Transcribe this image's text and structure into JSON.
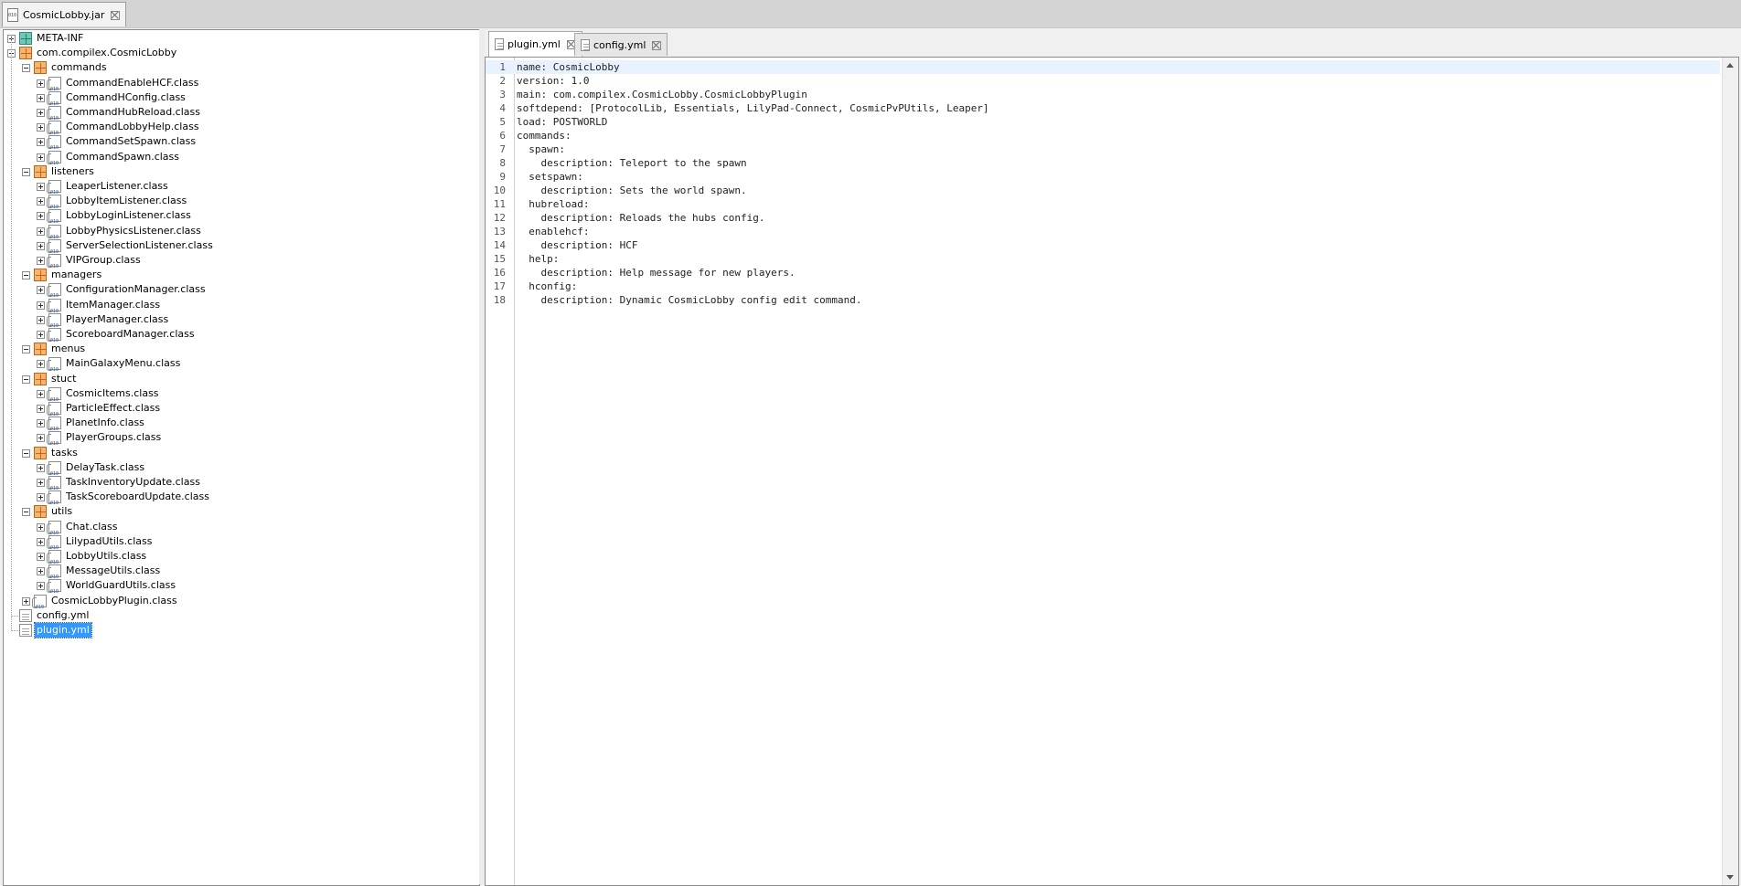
{
  "window": {
    "file_tab_label": "CosmicLobby.jar"
  },
  "tree": {
    "items": [
      {
        "label": "META-INF",
        "type": "meta",
        "depth": 0,
        "expander": "plus"
      },
      {
        "label": "com.compilex.CosmicLobby",
        "type": "pkg",
        "depth": 0,
        "expander": "minus"
      },
      {
        "label": "commands",
        "type": "pkg",
        "depth": 1,
        "expander": "minus"
      },
      {
        "label": "CommandEnableHCF.class",
        "type": "class",
        "depth": 2,
        "expander": "plus"
      },
      {
        "label": "CommandHConfig.class",
        "type": "class",
        "depth": 2,
        "expander": "plus"
      },
      {
        "label": "CommandHubReload.class",
        "type": "class",
        "depth": 2,
        "expander": "plus"
      },
      {
        "label": "CommandLobbyHelp.class",
        "type": "class",
        "depth": 2,
        "expander": "plus"
      },
      {
        "label": "CommandSetSpawn.class",
        "type": "class",
        "depth": 2,
        "expander": "plus"
      },
      {
        "label": "CommandSpawn.class",
        "type": "class",
        "depth": 2,
        "expander": "plus"
      },
      {
        "label": "listeners",
        "type": "pkg",
        "depth": 1,
        "expander": "minus"
      },
      {
        "label": "LeaperListener.class",
        "type": "class",
        "depth": 2,
        "expander": "plus"
      },
      {
        "label": "LobbyItemListener.class",
        "type": "class",
        "depth": 2,
        "expander": "plus"
      },
      {
        "label": "LobbyLoginListener.class",
        "type": "class",
        "depth": 2,
        "expander": "plus"
      },
      {
        "label": "LobbyPhysicsListener.class",
        "type": "class",
        "depth": 2,
        "expander": "plus"
      },
      {
        "label": "ServerSelectionListener.class",
        "type": "class",
        "depth": 2,
        "expander": "plus"
      },
      {
        "label": "VIPGroup.class",
        "type": "class",
        "depth": 2,
        "expander": "plus"
      },
      {
        "label": "managers",
        "type": "pkg",
        "depth": 1,
        "expander": "minus"
      },
      {
        "label": "ConfigurationManager.class",
        "type": "class",
        "depth": 2,
        "expander": "plus"
      },
      {
        "label": "ItemManager.class",
        "type": "class",
        "depth": 2,
        "expander": "plus"
      },
      {
        "label": "PlayerManager.class",
        "type": "class",
        "depth": 2,
        "expander": "plus"
      },
      {
        "label": "ScoreboardManager.class",
        "type": "class",
        "depth": 2,
        "expander": "plus"
      },
      {
        "label": "menus",
        "type": "pkg",
        "depth": 1,
        "expander": "minus"
      },
      {
        "label": "MainGalaxyMenu.class",
        "type": "class",
        "depth": 2,
        "expander": "plus"
      },
      {
        "label": "stuct",
        "type": "pkg",
        "depth": 1,
        "expander": "minus"
      },
      {
        "label": "CosmicItems.class",
        "type": "class",
        "depth": 2,
        "expander": "plus"
      },
      {
        "label": "ParticleEffect.class",
        "type": "class",
        "depth": 2,
        "expander": "plus"
      },
      {
        "label": "PlanetInfo.class",
        "type": "class",
        "depth": 2,
        "expander": "plus"
      },
      {
        "label": "PlayerGroups.class",
        "type": "class",
        "depth": 2,
        "expander": "plus"
      },
      {
        "label": "tasks",
        "type": "pkg",
        "depth": 1,
        "expander": "minus"
      },
      {
        "label": "DelayTask.class",
        "type": "class",
        "depth": 2,
        "expander": "plus"
      },
      {
        "label": "TaskInventoryUpdate.class",
        "type": "class",
        "depth": 2,
        "expander": "plus"
      },
      {
        "label": "TaskScoreboardUpdate.class",
        "type": "class",
        "depth": 2,
        "expander": "plus"
      },
      {
        "label": "utils",
        "type": "pkg",
        "depth": 1,
        "expander": "minus"
      },
      {
        "label": "Chat.class",
        "type": "class",
        "depth": 2,
        "expander": "plus"
      },
      {
        "label": "LilypadUtils.class",
        "type": "class",
        "depth": 2,
        "expander": "plus"
      },
      {
        "label": "LobbyUtils.class",
        "type": "class",
        "depth": 2,
        "expander": "plus"
      },
      {
        "label": "MessageUtils.class",
        "type": "class",
        "depth": 2,
        "expander": "plus"
      },
      {
        "label": "WorldGuardUtils.class",
        "type": "class",
        "depth": 2,
        "expander": "plus"
      },
      {
        "label": "CosmicLobbyPlugin.class",
        "type": "class",
        "depth": 1,
        "expander": "plus"
      },
      {
        "label": "config.yml",
        "type": "file",
        "depth": 0,
        "expander": "none"
      },
      {
        "label": "plugin.yml",
        "type": "file",
        "depth": 0,
        "expander": "none",
        "selected": true
      }
    ]
  },
  "editor": {
    "tabs": [
      {
        "label": "plugin.yml",
        "active": true
      },
      {
        "label": "config.yml",
        "active": false
      }
    ],
    "lines": [
      "name: CosmicLobby",
      "version: 1.0",
      "main: com.compilex.CosmicLobby.CosmicLobbyPlugin",
      "softdepend: [ProtocolLib, Essentials, LilyPad-Connect, CosmicPvPUtils, Leaper]",
      "load: POSTWORLD",
      "commands:",
      "  spawn:",
      "    description: Teleport to the spawn",
      "  setspawn:",
      "    description: Sets the world spawn.",
      "  hubreload:",
      "    description: Reloads the hubs config.",
      "  enablehcf:",
      "    description: HCF",
      "  help:",
      "    description: Help message for new players.",
      "  hconfig:",
      "    description: Dynamic CosmicLobby config edit command."
    ],
    "current_line": 1
  }
}
